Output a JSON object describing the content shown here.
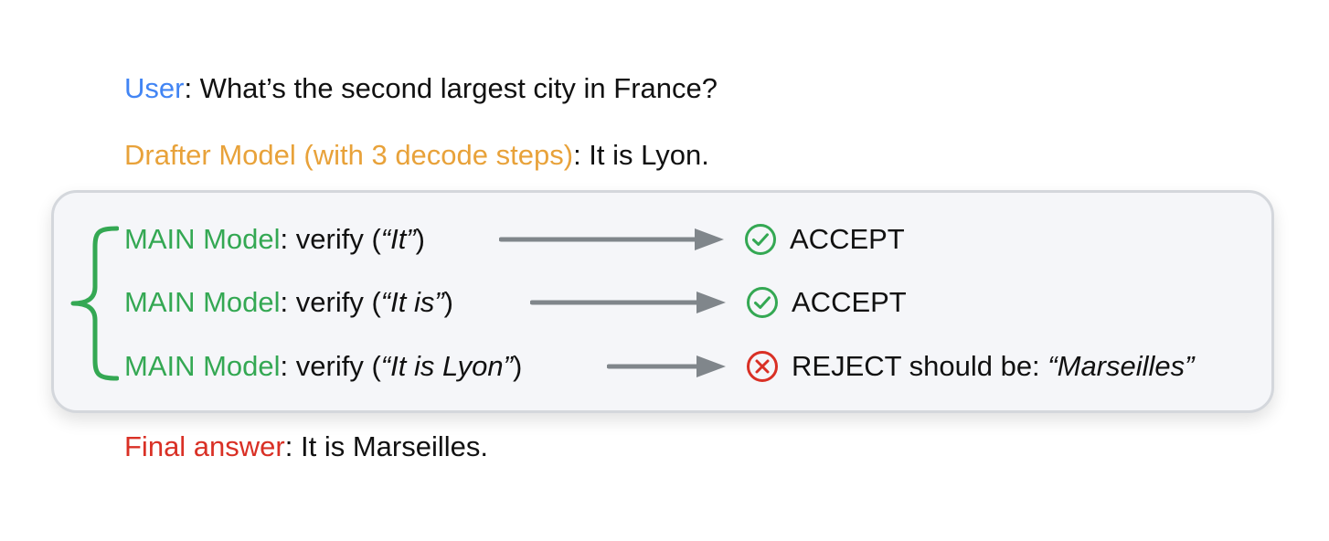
{
  "user": {
    "role": "User",
    "text": ": What’s the second largest city in France?"
  },
  "drafter": {
    "role": "Drafter Model (with 3 decode steps)",
    "text": ": It is Lyon."
  },
  "verifications": [
    {
      "role": "MAIN Model",
      "prefix": ": verify (",
      "quote": "“It”",
      "suffix": ")",
      "status": "ACCEPT",
      "status_icon": "check-circle-icon"
    },
    {
      "role": "MAIN Model",
      "prefix": ": verify (",
      "quote": "“It is”",
      "suffix": ")",
      "status": "ACCEPT",
      "status_icon": "check-circle-icon"
    },
    {
      "role": "MAIN Model",
      "prefix": ": verify (",
      "quote": "“It is Lyon”",
      "suffix": ")",
      "status": "REJECT should be: ",
      "correction": "“Marseilles”",
      "status_icon": "x-circle-icon"
    }
  ],
  "final": {
    "role": "Final answer",
    "text": ": It is Marseilles."
  },
  "colors": {
    "user": "#4285F4",
    "drafter": "#E8A23A",
    "main": "#34A853",
    "final": "#D93025",
    "arrow": "#80868B",
    "box_bg": "#F5F6F9",
    "box_border": "#D4D7DC"
  }
}
